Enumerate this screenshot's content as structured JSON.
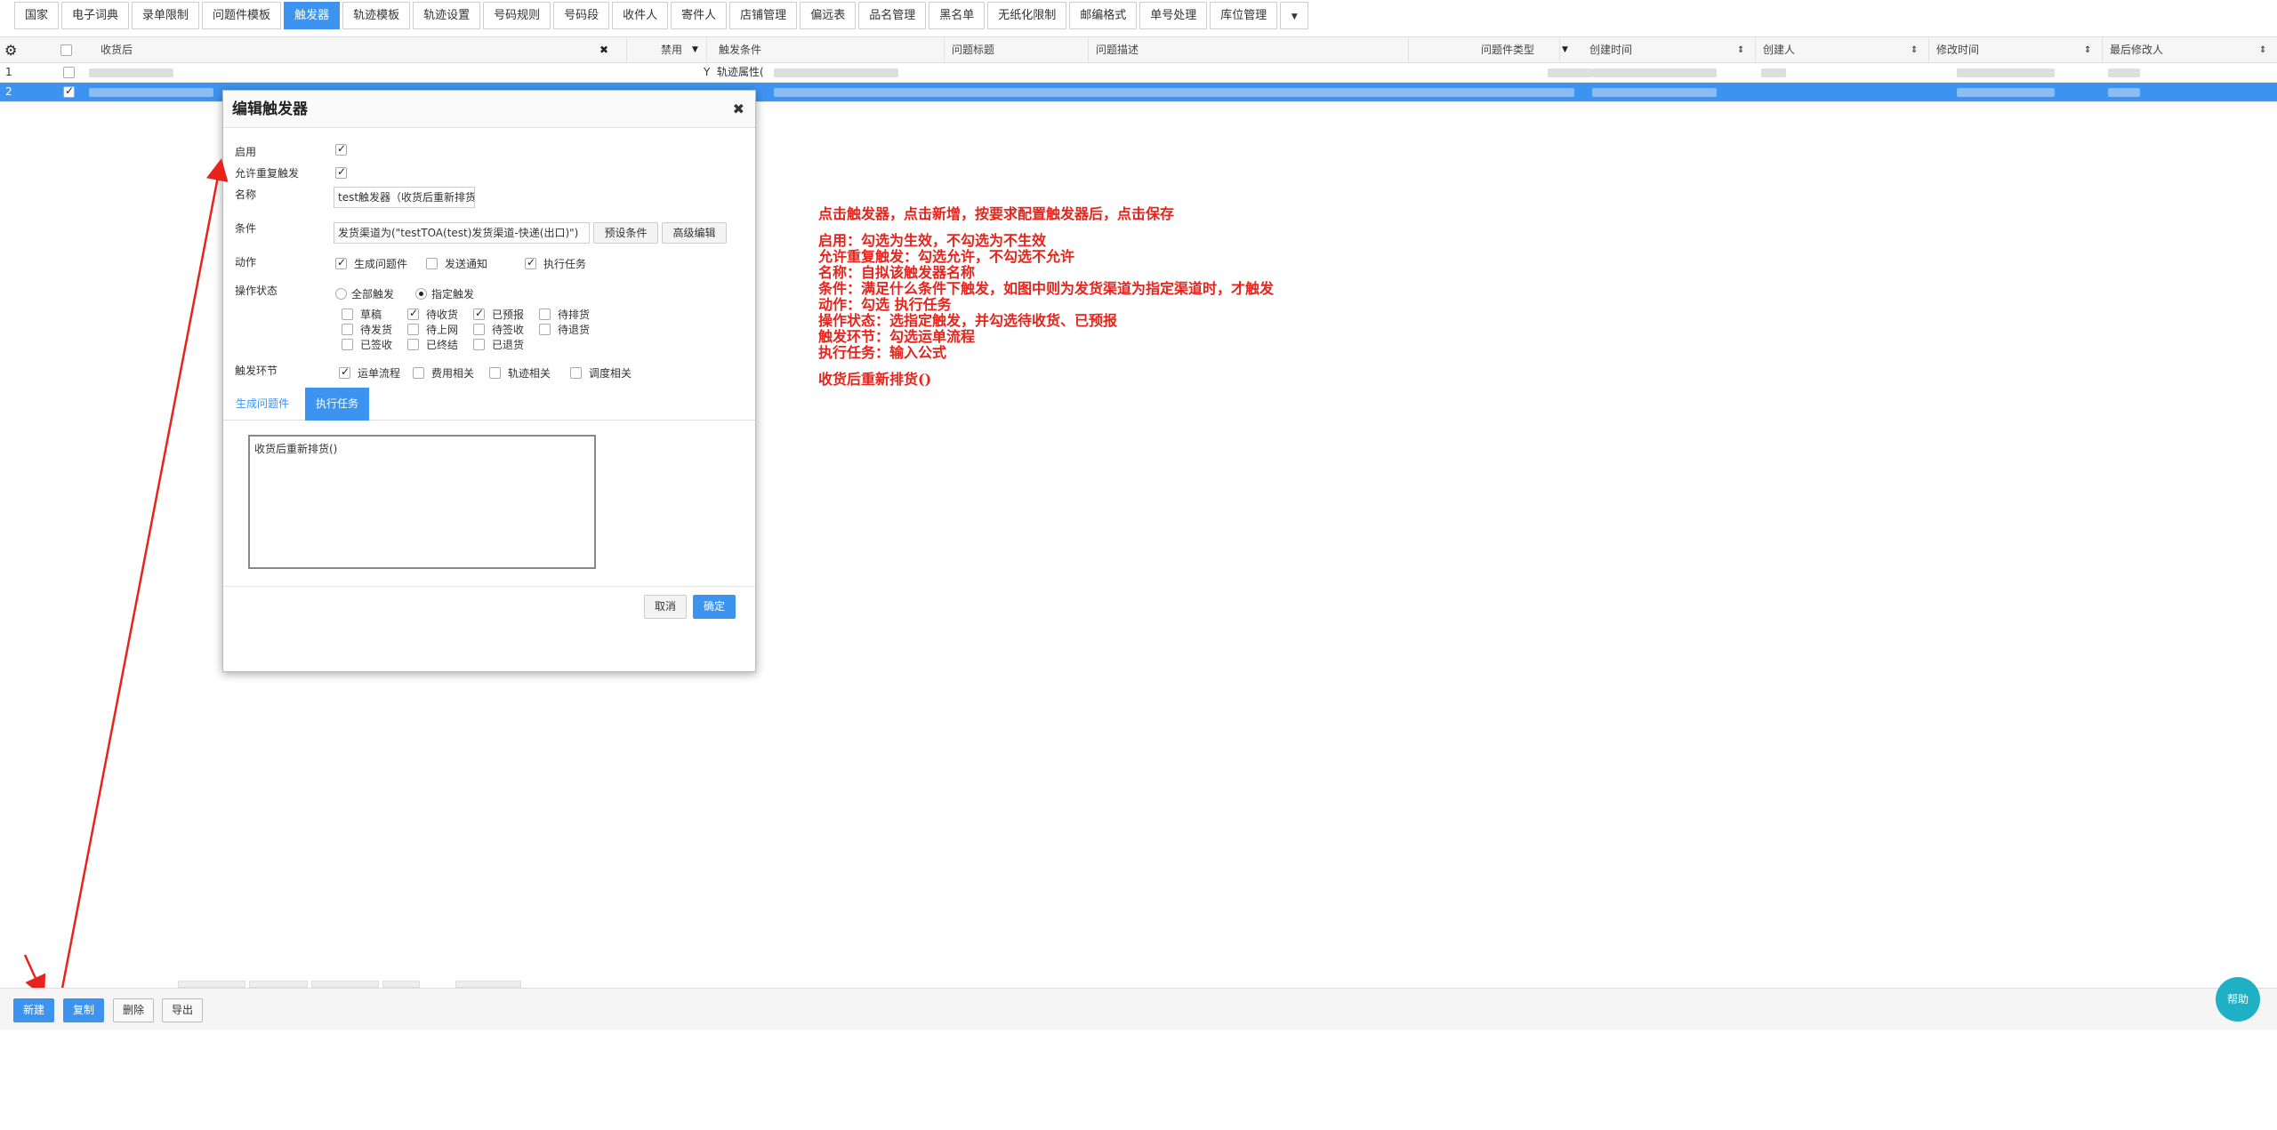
{
  "tabs": [
    {
      "label": "国家",
      "active": false
    },
    {
      "label": "电子词典",
      "active": false
    },
    {
      "label": "录单限制",
      "active": false
    },
    {
      "label": "问题件模板",
      "active": false
    },
    {
      "label": "触发器",
      "active": true
    },
    {
      "label": "轨迹模板",
      "active": false
    },
    {
      "label": "轨迹设置",
      "active": false
    },
    {
      "label": "号码规则",
      "active": false
    },
    {
      "label": "号码段",
      "active": false
    },
    {
      "label": "收件人",
      "active": false
    },
    {
      "label": "寄件人",
      "active": false
    },
    {
      "label": "店铺管理",
      "active": false
    },
    {
      "label": "偏远表",
      "active": false
    },
    {
      "label": "品名管理",
      "active": false
    },
    {
      "label": "黑名单",
      "active": false
    },
    {
      "label": "无纸化限制",
      "active": false
    },
    {
      "label": "邮编格式",
      "active": false
    },
    {
      "label": "单号处理",
      "active": false
    },
    {
      "label": "库位管理",
      "active": false
    }
  ],
  "grid": {
    "filter_value": "收货后",
    "columns": {
      "disabled": "禁用",
      "condition": "触发条件",
      "title": "问题标题",
      "description": "问题描述",
      "type": "问题件类型",
      "created_time": "创建时间",
      "creator": "创建人",
      "modified_time": "修改时间",
      "modifier": "最后修改人"
    },
    "rows": [
      {
        "num": "1",
        "disabled": "Y",
        "condition": "轨迹属性(",
        "selected": false
      },
      {
        "num": "2",
        "disabled": "",
        "condition": "",
        "selected": true
      }
    ]
  },
  "dialog": {
    "title": "编辑触发器",
    "enable_label": "启用",
    "enable_checked": true,
    "repeat_label": "允许重复触发",
    "repeat_checked": true,
    "name_label": "名称",
    "name_value": "test触发器（收货后重新排货）",
    "condition_label": "条件",
    "condition_value": "发货渠道为(\"testTOA(test)发货渠道-快递(出口)\")",
    "preset_btn": "预设条件",
    "advanced_btn": "高级编辑",
    "action_label": "动作",
    "actions": [
      {
        "label": "生成问题件",
        "checked": true
      },
      {
        "label": "发送通知",
        "checked": false
      },
      {
        "label": "执行任务",
        "checked": true
      }
    ],
    "opstate_label": "操作状态",
    "op_radios": [
      {
        "label": "全部触发",
        "on": false
      },
      {
        "label": "指定触发",
        "on": true
      }
    ],
    "op_states": [
      {
        "label": "草稿",
        "checked": false
      },
      {
        "label": "待收货",
        "checked": true
      },
      {
        "label": "已预报",
        "checked": true
      },
      {
        "label": "待排货",
        "checked": false
      },
      {
        "label": "待发货",
        "checked": false
      },
      {
        "label": "待上网",
        "checked": false
      },
      {
        "label": "待签收",
        "checked": false
      },
      {
        "label": "待退货",
        "checked": false
      },
      {
        "label": "已签收",
        "checked": false
      },
      {
        "label": "已终结",
        "checked": false
      },
      {
        "label": "已退货",
        "checked": false
      }
    ],
    "stage_label": "触发环节",
    "stages": [
      {
        "label": "运单流程",
        "checked": true
      },
      {
        "label": "费用相关",
        "checked": false
      },
      {
        "label": "轨迹相关",
        "checked": false
      },
      {
        "label": "调度相关",
        "checked": false
      }
    ],
    "subtabs": [
      {
        "label": "生成问题件",
        "active": false
      },
      {
        "label": "执行任务",
        "active": true
      }
    ],
    "task_formula": "收货后重新排货()",
    "cancel_btn": "取消",
    "ok_btn": "确定"
  },
  "annotations": {
    "heading": "点击触发器，点击新增，按要求配置触发器后，点击保存",
    "lines": [
      "启用：勾选为生效，不勾选为不生效",
      "允许重复触发：勾选允许，不勾选不允许",
      "名称：自拟该触发器名称",
      "条件：满足什么条件下触发，如图中则为发货渠道为指定渠道时，才触发",
      "动作：勾选 执行任务",
      "操作状态：选指定触发，并勾选待收货、已预报",
      "触发环节：勾选运单流程",
      "执行任务：输入公式"
    ],
    "formula": "收货后重新排货()",
    "color": "#e8231b"
  },
  "bottom": {
    "new_btn": "新建",
    "copy_btn": "复制",
    "delete_btn": "删除",
    "export_btn": "导出",
    "help_btn": "帮助"
  }
}
